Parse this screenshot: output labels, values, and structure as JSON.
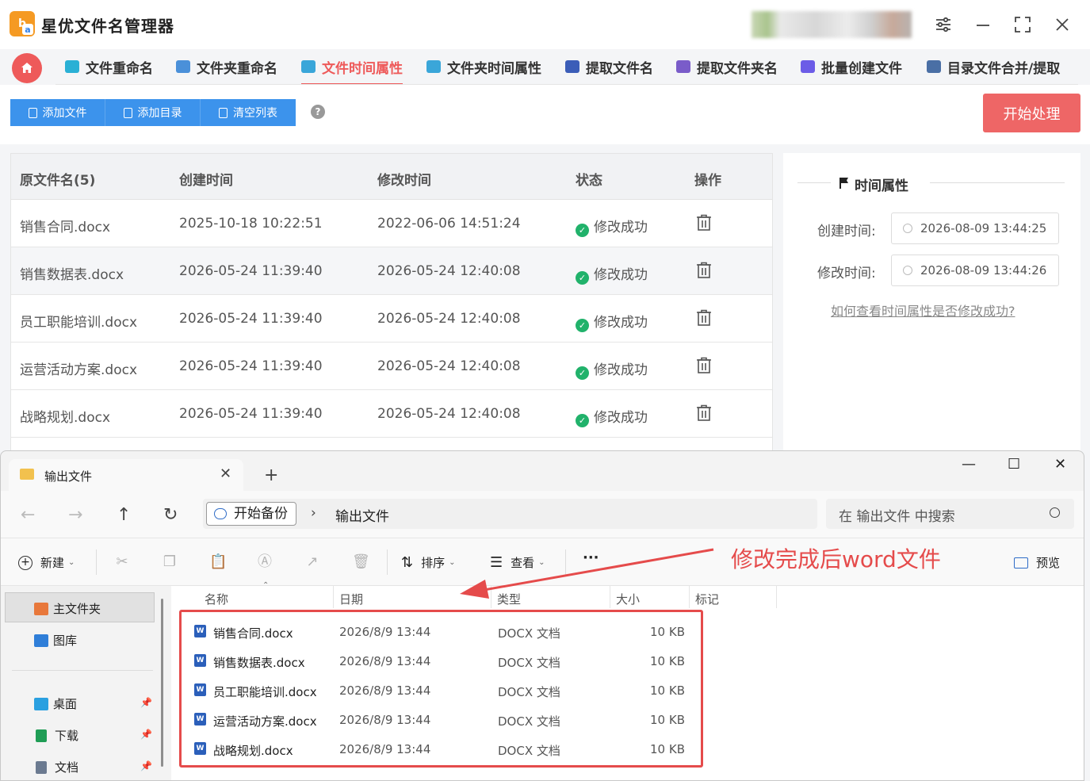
{
  "app": {
    "title": "星优文件名管理器",
    "logo_glyph": "b",
    "logo_sub": "a"
  },
  "window_controls": {
    "settings": "⚙",
    "minimize": "—",
    "maximize": "⛶",
    "close": "✕"
  },
  "nav": {
    "tabs": [
      {
        "label": "文件重命名",
        "color": "#2ab0d5"
      },
      {
        "label": "文件夹重命名",
        "color": "#4a90d9"
      },
      {
        "label": "文件时间属性",
        "color": "#3aa6d9",
        "active": true
      },
      {
        "label": "文件夹时间属性",
        "color": "#3aa6d9"
      },
      {
        "label": "提取文件名",
        "color": "#3b5db8"
      },
      {
        "label": "提取文件夹名",
        "color": "#7a5cc9"
      },
      {
        "label": "批量创建文件",
        "color": "#6c5ce7"
      },
      {
        "label": "目录文件合并/提取",
        "color": "#4a6fa5"
      }
    ]
  },
  "toolbar": {
    "add_file": "添加文件",
    "add_dir": "添加目录",
    "clear_list": "清空列表",
    "help": "?",
    "start": "开始处理"
  },
  "table": {
    "headers": [
      "原文件名(5)",
      "创建时间",
      "修改时间",
      "状态",
      "操作"
    ],
    "rows": [
      {
        "name": "销售合同.docx",
        "created": "2025-10-18 10:22:51",
        "modified": "2022-06-06 14:51:24",
        "status": "修改成功"
      },
      {
        "name": "销售数据表.docx",
        "created": "2026-05-24 11:39:40",
        "modified": "2026-05-24 12:40:08",
        "status": "修改成功"
      },
      {
        "name": "员工职能培训.docx",
        "created": "2026-05-24 11:39:40",
        "modified": "2026-05-24 12:40:08",
        "status": "修改成功"
      },
      {
        "name": "运营活动方案.docx",
        "created": "2026-05-24 11:39:40",
        "modified": "2026-05-24 12:40:08",
        "status": "修改成功"
      },
      {
        "name": "战略规划.docx",
        "created": "2026-05-24 11:39:40",
        "modified": "2026-05-24 12:40:08",
        "status": "修改成功"
      }
    ]
  },
  "panel": {
    "title": "时间属性",
    "created_label": "创建时间:",
    "created_value": "2026-08-09 13:44:25",
    "modified_label": "修改时间:",
    "modified_value": "2026-08-09 13:44:26",
    "help_link": "如何查看时间属性是否修改成功?"
  },
  "explorer": {
    "tab_title": "输出文件",
    "crumb_root": "开始备份",
    "crumb_current": "输出文件",
    "search_placeholder": "在 输出文件 中搜索",
    "cmd": {
      "new": "新建",
      "sort": "排序",
      "view": "查看",
      "more": "···",
      "preview": "预览"
    },
    "sidebar": [
      {
        "label": "主文件夹",
        "icon": "home-icon",
        "color": "#e8783b"
      },
      {
        "label": "图库",
        "icon": "gallery-icon",
        "color": "#2f7ed8"
      },
      {
        "label": "桌面",
        "icon": "desktop-icon",
        "color": "#2aa0e0"
      },
      {
        "label": "下载",
        "icon": "download-icon",
        "color": "#1f9d55"
      },
      {
        "label": "文档",
        "icon": "document-icon",
        "color": "#6b7a90"
      }
    ],
    "columns": [
      "名称",
      "日期",
      "类型",
      "大小",
      "标记"
    ],
    "files": [
      {
        "name": "销售合同.docx",
        "date": "2026/8/9 13:44",
        "type": "DOCX 文档",
        "size": "10 KB"
      },
      {
        "name": "销售数据表.docx",
        "date": "2026/8/9 13:44",
        "type": "DOCX 文档",
        "size": "10 KB"
      },
      {
        "name": "员工职能培训.docx",
        "date": "2026/8/9 13:44",
        "type": "DOCX 文档",
        "size": "10 KB"
      },
      {
        "name": "运营活动方案.docx",
        "date": "2026/8/9 13:44",
        "type": "DOCX 文档",
        "size": "10 KB"
      },
      {
        "name": "战略规划.docx",
        "date": "2026/8/9 13:44",
        "type": "DOCX 文档",
        "size": "10 KB"
      }
    ]
  },
  "annotation": "修改完成后word文件",
  "colors": {
    "accent_red": "#ee5a5a",
    "primary_blue": "#3c93ec",
    "success_green": "#21b26b"
  }
}
